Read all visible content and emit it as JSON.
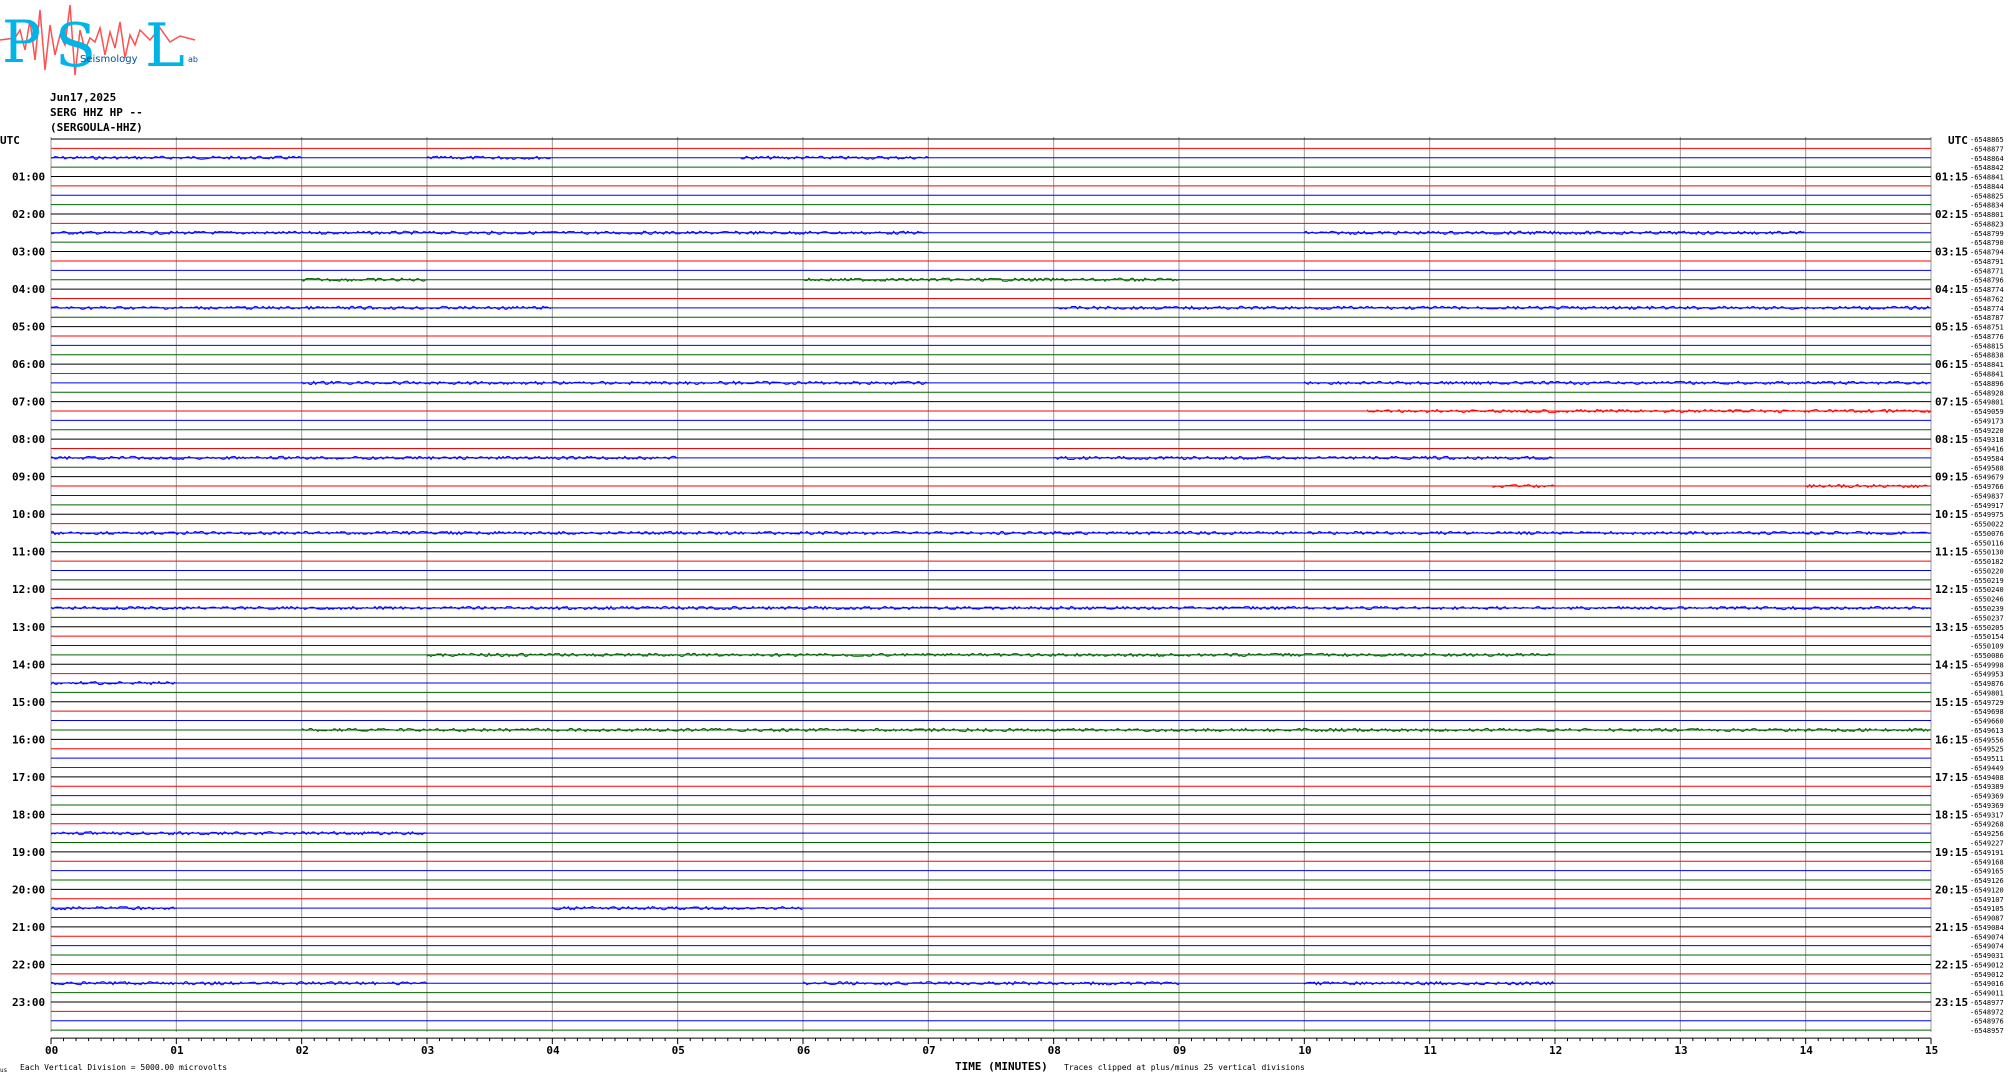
{
  "logo": {
    "letters": [
      "P",
      "S",
      "L"
    ],
    "text": "Seismology",
    "tail": "ab"
  },
  "header": {
    "date": "Jun17,2025",
    "station": "SERG HHZ HP --",
    "name": "(SERGOULA-HHZ)"
  },
  "chart_data": {
    "type": "line",
    "left_corner": "UTC",
    "right_corner": "UTC",
    "left_hours": [
      "01:00",
      "02:00",
      "03:00",
      "04:00",
      "05:00",
      "06:00",
      "07:00",
      "08:00",
      "09:00",
      "10:00",
      "11:00",
      "12:00",
      "13:00",
      "14:00",
      "15:00",
      "16:00",
      "17:00",
      "18:00",
      "19:00",
      "20:00",
      "21:00",
      "22:00",
      "23:00"
    ],
    "right_hours": [
      "01:15",
      "02:15",
      "03:15",
      "04:15",
      "05:15",
      "06:15",
      "07:15",
      "08:15",
      "09:15",
      "10:15",
      "11:15",
      "12:15",
      "13:15",
      "14:15",
      "15:15",
      "16:15",
      "17:15",
      "18:15",
      "19:15",
      "20:15",
      "21:15",
      "22:15",
      "23:15"
    ],
    "x_ticks": [
      "00",
      "01",
      "02",
      "03",
      "04",
      "05",
      "06",
      "07",
      "08",
      "09",
      "10",
      "11",
      "12",
      "13",
      "14",
      "15"
    ],
    "xlim": [
      0,
      15
    ],
    "rows": 96,
    "row_colors": [
      "#000000",
      "#ff0000",
      "#0000ff",
      "#006400"
    ],
    "row_values": [
      "-6548865",
      "-6548877",
      "-6548864",
      "-6548842",
      "-6548841",
      "-6548844",
      "-6548825",
      "-6548834",
      "-6548801",
      "-6548823",
      "-6548799",
      "-6548790",
      "-6548794",
      "-6548791",
      "-6548771",
      "-6548796",
      "-6548774",
      "-6548762",
      "-6548774",
      "-6548787",
      "-6548751",
      "-6548776",
      "-6548815",
      "-6548838",
      "-6548841",
      "-6548841",
      "-6548896",
      "-6548928",
      "-6549801",
      "-6549059",
      "-6549173",
      "-6549220",
      "-6549318",
      "-6549416",
      "-6549584",
      "-6549588",
      "-6549679",
      "-6549766",
      "-6549837",
      "-6549917",
      "-6549975",
      "-6550022",
      "-6550076",
      "-6550116",
      "-6550130",
      "-6550182",
      "-6550220",
      "-6550219",
      "-6550240",
      "-6550246",
      "-6550239",
      "-6550237",
      "-6550205",
      "-6550154",
      "-6550109",
      "-6550086",
      "-6549998",
      "-6549953",
      "-6549876",
      "-6549801",
      "-6549729",
      "-6549698",
      "-6549660",
      "-6549613",
      "-6549556",
      "-6549525",
      "-6549511",
      "-6549449",
      "-6549408",
      "-6549389",
      "-6549369",
      "-6549369",
      "-6549317",
      "-6549268",
      "-6549256",
      "-6549227",
      "-6549191",
      "-6549168",
      "-6549165",
      "-6549126",
      "-6549120",
      "-6549107",
      "-6549105",
      "-6549087",
      "-6549084",
      "-6549074",
      "-6549074",
      "-6549031",
      "-6549012",
      "-6549012",
      "-6549016",
      "-6549011",
      "-6548977",
      "-6548972",
      "-6548976",
      "-6548957"
    ],
    "xlabel": "TIME (MINUTES)",
    "footer_left": "Each Vertical Division = 5000.00 microvolts",
    "footer_right": "Traces clipped at plus/minus 25 vertical divisions",
    "corner_mark": "us",
    "noisy_rows": [
      {
        "row": 2,
        "segments": [
          [
            0,
            2
          ],
          [
            3,
            4
          ],
          [
            5.5,
            7
          ]
        ]
      },
      {
        "row": 10,
        "segments": [
          [
            0,
            2
          ],
          [
            2,
            7
          ],
          [
            10,
            14
          ]
        ]
      },
      {
        "row": 15,
        "segments": [
          [
            2,
            3
          ],
          [
            6,
            9
          ]
        ]
      },
      {
        "row": 18,
        "segments": [
          [
            0,
            4
          ],
          [
            8,
            15
          ]
        ]
      },
      {
        "row": 26,
        "segments": [
          [
            2,
            7
          ],
          [
            10,
            15
          ]
        ]
      },
      {
        "row": 29,
        "segments": [
          [
            10.5,
            15
          ]
        ]
      },
      {
        "row": 34,
        "segments": [
          [
            0,
            5
          ],
          [
            8,
            12
          ]
        ]
      },
      {
        "row": 37,
        "segments": [
          [
            11.5,
            12
          ],
          [
            14,
            15
          ]
        ]
      },
      {
        "row": 42,
        "segments": [
          [
            0,
            15
          ]
        ]
      },
      {
        "row": 50,
        "segments": [
          [
            0,
            15
          ]
        ]
      },
      {
        "row": 55,
        "segments": [
          [
            3,
            12
          ]
        ]
      },
      {
        "row": 58,
        "segments": [
          [
            0,
            1
          ]
        ]
      },
      {
        "row": 63,
        "segments": [
          [
            2,
            15
          ]
        ]
      },
      {
        "row": 74,
        "segments": [
          [
            0,
            1
          ],
          [
            1,
            3
          ]
        ]
      },
      {
        "row": 82,
        "segments": [
          [
            0,
            1
          ],
          [
            4,
            6
          ]
        ]
      },
      {
        "row": 90,
        "segments": [
          [
            0,
            3
          ],
          [
            6,
            9
          ],
          [
            10,
            12
          ]
        ]
      }
    ]
  }
}
